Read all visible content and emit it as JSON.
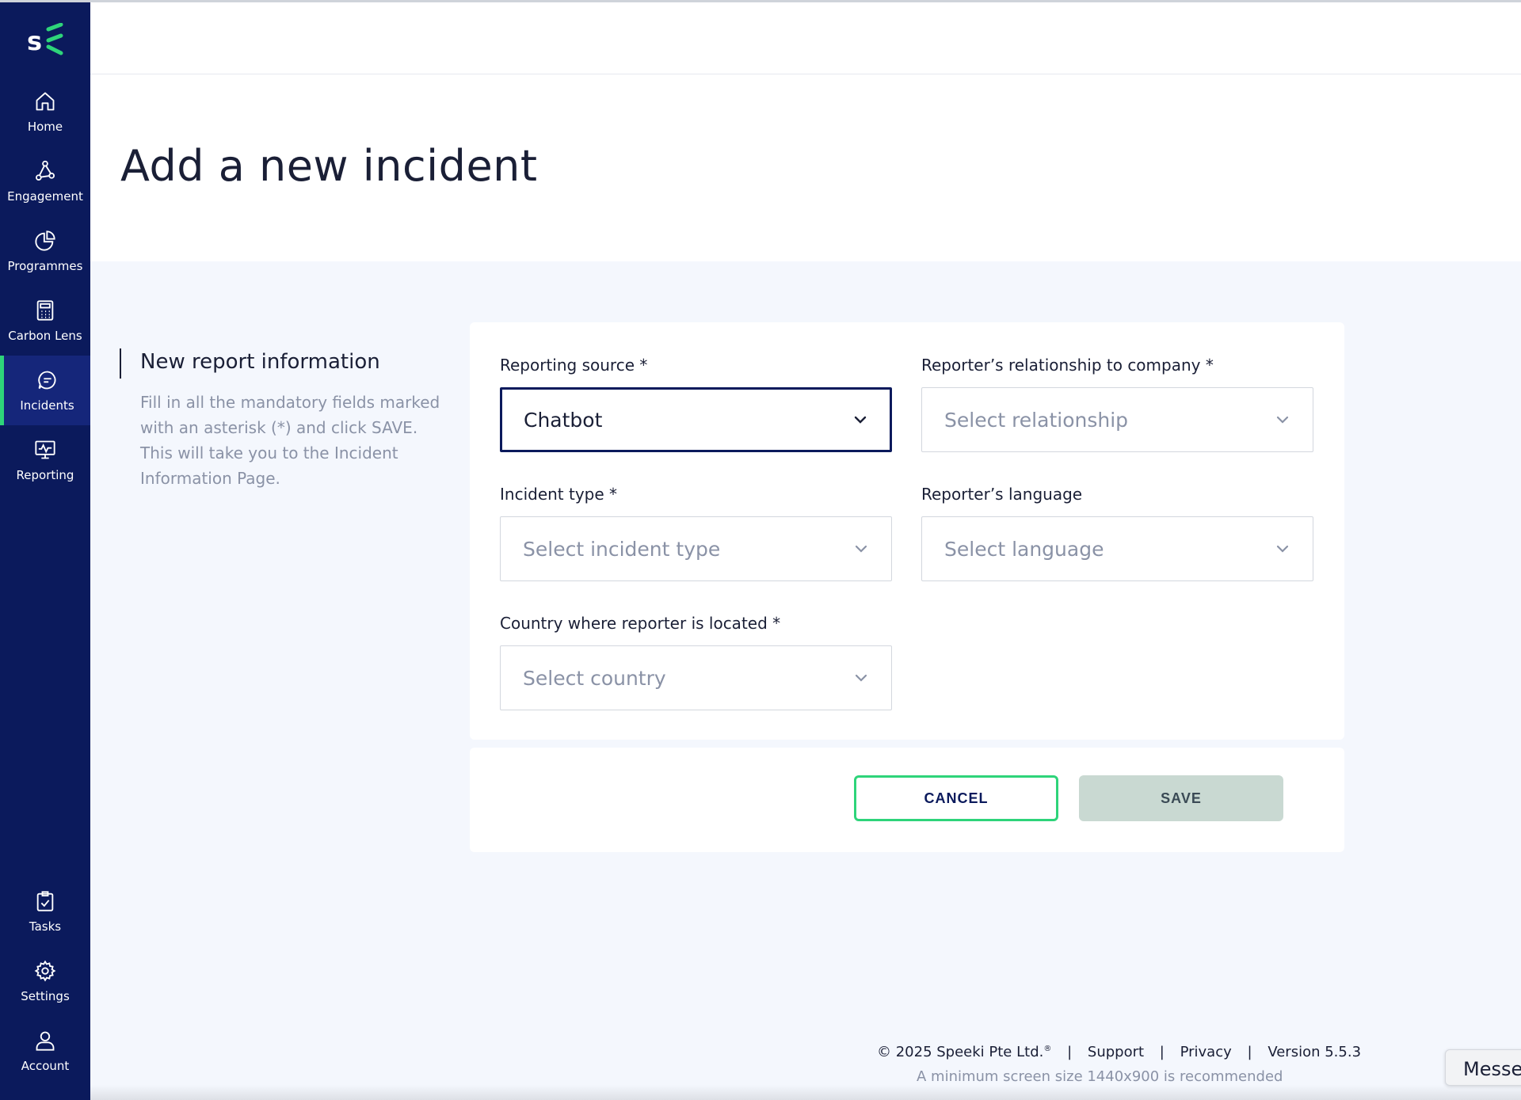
{
  "nav": {
    "items": [
      {
        "label": "Home",
        "icon": "home-icon"
      },
      {
        "label": "Engagement",
        "icon": "network-icon"
      },
      {
        "label": "Programmes",
        "icon": "pie-chart-icon"
      },
      {
        "label": "Carbon Lens",
        "icon": "calculator-icon"
      },
      {
        "label": "Incidents",
        "icon": "chat-bubble-icon",
        "active": true
      },
      {
        "label": "Reporting",
        "icon": "monitor-chart-icon"
      }
    ],
    "bottom_items": [
      {
        "label": "Tasks",
        "icon": "clipboard-check-icon"
      },
      {
        "label": "Settings",
        "icon": "gear-icon"
      },
      {
        "label": "Account",
        "icon": "user-icon"
      }
    ],
    "accent_color": "#2ed47a",
    "background_color": "#0b1a5c"
  },
  "page": {
    "title": "Add a new incident"
  },
  "info": {
    "title": "New report information",
    "description": "Fill in all the mandatory fields marked with an asterisk (*) and click SAVE. This will take you to the Incident Information Page."
  },
  "form": {
    "reporting_source": {
      "label": "Reporting source *",
      "value": "Chatbot"
    },
    "relationship": {
      "label": "Reporter’s relationship to company *",
      "placeholder": "Select relationship"
    },
    "incident_type": {
      "label": "Incident type *",
      "placeholder": "Select incident type"
    },
    "language": {
      "label": "Reporter’s language",
      "placeholder": "Select language"
    },
    "country": {
      "label": "Country where reporter is located *",
      "placeholder": "Select country"
    }
  },
  "actions": {
    "cancel_label": "CANCEL",
    "save_label": "SAVE"
  },
  "footer": {
    "copyright": "© 2025 Speeki Pte Ltd.",
    "registered": "®",
    "support": "Support",
    "privacy": "Privacy",
    "version": "Version 5.5.3",
    "note": "A minimum screen size 1440x900 is recommended",
    "separator": "|"
  },
  "messenger": {
    "label": "Messe"
  }
}
